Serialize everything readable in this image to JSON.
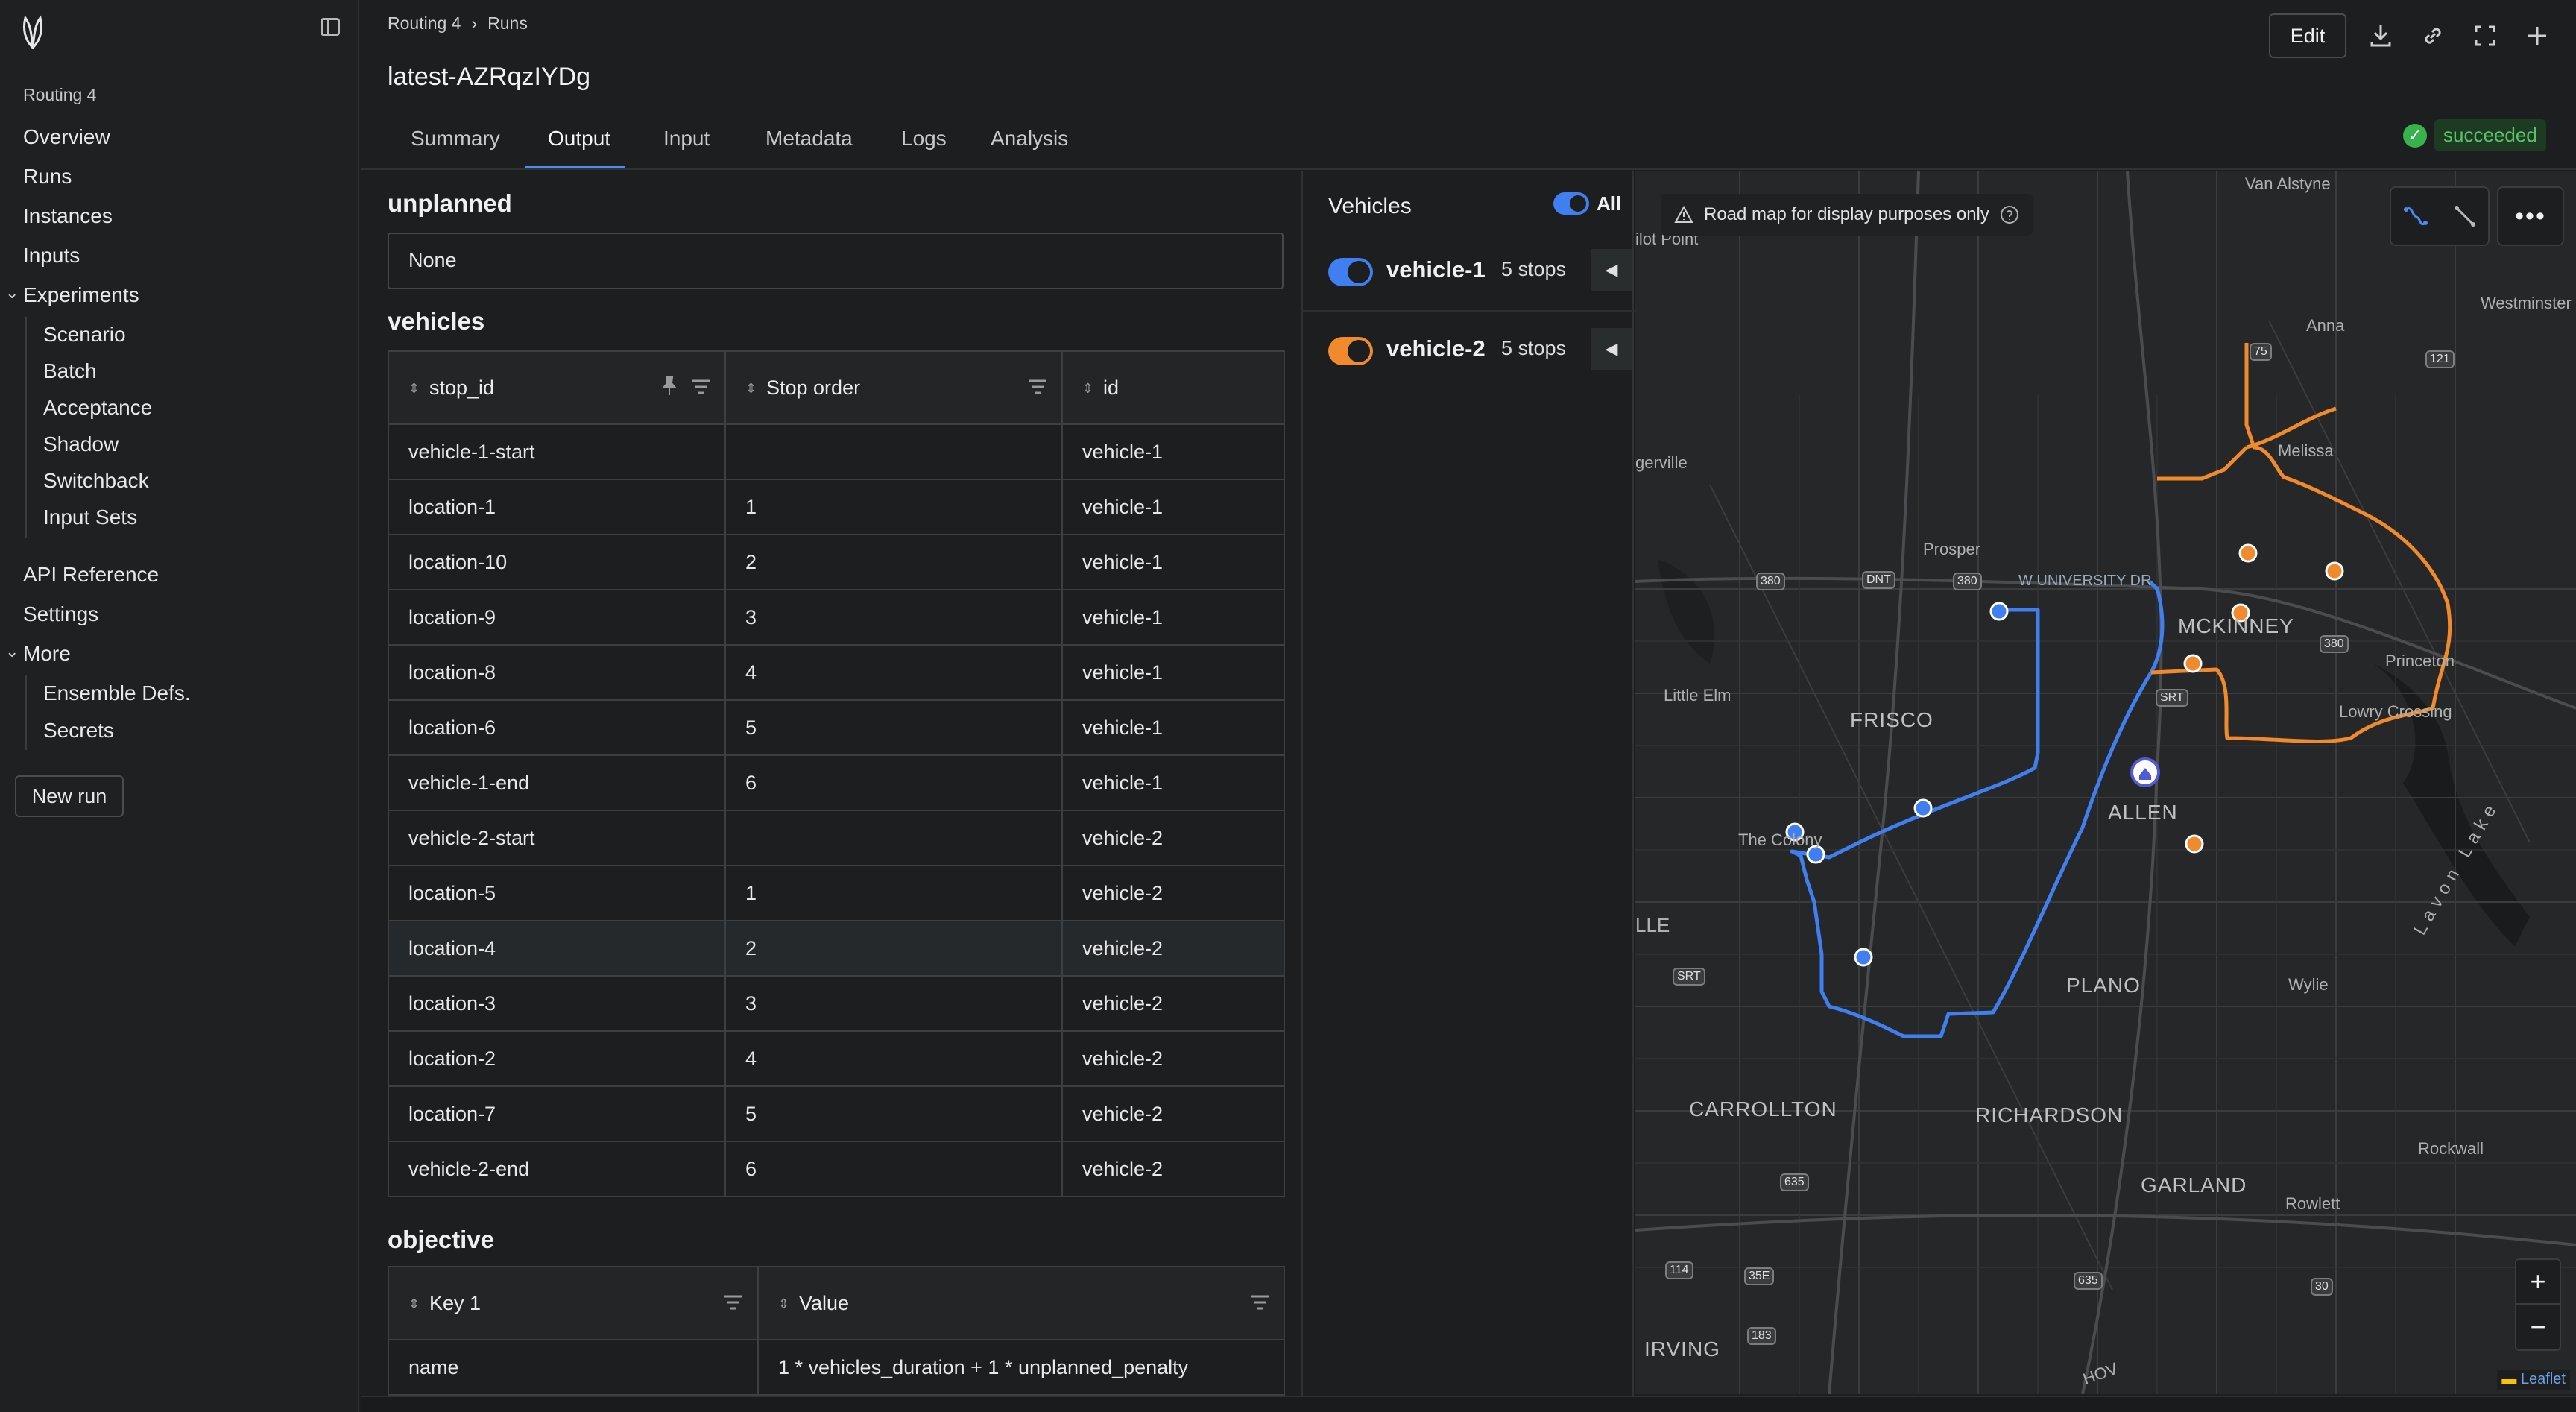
{
  "sidebar": {
    "project": "Routing 4",
    "items": [
      {
        "label": "Overview"
      },
      {
        "label": "Runs"
      },
      {
        "label": "Instances"
      },
      {
        "label": "Inputs"
      }
    ],
    "experiments": {
      "label": "Experiments",
      "children": [
        "Scenario",
        "Batch",
        "Acceptance",
        "Shadow",
        "Switchback",
        "Input Sets"
      ]
    },
    "api_reference": "API Reference",
    "settings": "Settings",
    "more": {
      "label": "More",
      "children": [
        "Ensemble Defs.",
        "Secrets"
      ]
    },
    "new_run": "New run"
  },
  "header": {
    "breadcrumb": [
      "Routing 4",
      "Runs"
    ],
    "title": "latest-AZRqzIYDg",
    "edit_label": "Edit",
    "tabs": [
      "Summary",
      "Output",
      "Input",
      "Metadata",
      "Logs",
      "Analysis"
    ],
    "active_tab": "Output",
    "status": "succeeded"
  },
  "output": {
    "unplanned_title": "unplanned",
    "unplanned_value": "None",
    "vehicles_title": "vehicles",
    "vehicles_columns": [
      "stop_id",
      "Stop order",
      "id"
    ],
    "vehicles_rows": [
      [
        "vehicle-1-start",
        "",
        "vehicle-1"
      ],
      [
        "location-1",
        "1",
        "vehicle-1"
      ],
      [
        "location-10",
        "2",
        "vehicle-1"
      ],
      [
        "location-9",
        "3",
        "vehicle-1"
      ],
      [
        "location-8",
        "4",
        "vehicle-1"
      ],
      [
        "location-6",
        "5",
        "vehicle-1"
      ],
      [
        "vehicle-1-end",
        "6",
        "vehicle-1"
      ],
      [
        "vehicle-2-start",
        "",
        "vehicle-2"
      ],
      [
        "location-5",
        "1",
        "vehicle-2"
      ],
      [
        "location-4",
        "2",
        "vehicle-2"
      ],
      [
        "location-3",
        "3",
        "vehicle-2"
      ],
      [
        "location-2",
        "4",
        "vehicle-2"
      ],
      [
        "location-7",
        "5",
        "vehicle-2"
      ],
      [
        "vehicle-2-end",
        "6",
        "vehicle-2"
      ]
    ],
    "objective_title": "objective",
    "objective_columns": [
      "Key 1",
      "Value"
    ],
    "objective_rows": [
      [
        "name",
        "1 * vehicles_duration + 1 * unplanned_penalty"
      ]
    ]
  },
  "vehicles_panel": {
    "title": "Vehicles",
    "all_label": "All",
    "vehicles": [
      {
        "name": "vehicle-1",
        "stops": "5 stops",
        "color": "#3f7ff0"
      },
      {
        "name": "vehicle-2",
        "stops": "5 stops",
        "color": "#f08a2c"
      }
    ]
  },
  "map": {
    "notice": "Road map for display purposes only",
    "attribution": "Leaflet",
    "zoom_in": "+",
    "zoom_out": "−",
    "more_label": "•••",
    "labels": {
      "van_alstyne": "Van Alstyne",
      "westminster": "Westminster",
      "anna": "Anna",
      "melissa": "Melissa",
      "prosper": "Prosper",
      "mckinney": "MCKINNEY",
      "princeton": "Princeton",
      "lowry_crossing": "Lowry Crossing",
      "little_elm": "Little Elm",
      "frisco": "FRISCO",
      "allen": "ALLEN",
      "the_colony": "The Colony",
      "plano": "PLANO",
      "wylie": "Wylie",
      "carrollton": "CARROLLTON",
      "richardson": "RICHARDSON",
      "garland": "GARLAND",
      "rowlett": "Rowlett",
      "rockwall": "Rockwall",
      "irving": "IRVING",
      "lavon_lake": "Lavon Lake",
      "w_university": "W UNIVERSITY DR",
      "pilot_point": "ilot Point",
      "aubrey": "gerville",
      "lle": "LLE",
      "hov": "HOV"
    },
    "shields": [
      "380",
      "DNT",
      "380",
      "380",
      "SRT",
      "SRT",
      "75",
      "121",
      "635",
      "114",
      "35E",
      "183",
      "635",
      "30"
    ]
  }
}
